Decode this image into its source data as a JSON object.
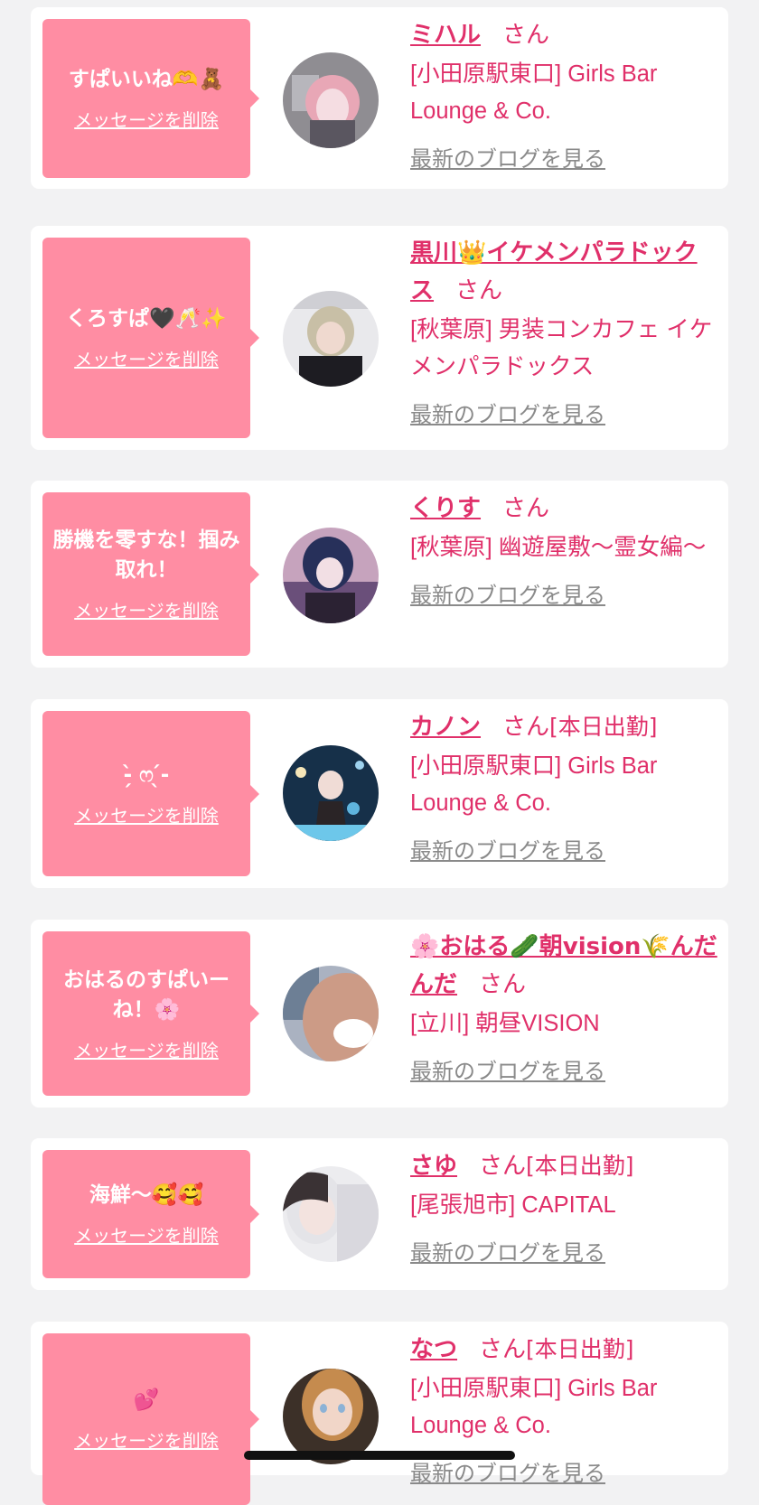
{
  "messages": [
    {
      "bubble_text": "すぱいいね🫶🧸",
      "delete_label": "メッセージを削除",
      "name": "ミハル",
      "suffix": "さん",
      "status": "",
      "shop": "[小田原駅東口] Girls Bar Lounge & Co.",
      "blog_link": "最新のブログを見る"
    },
    {
      "bubble_text": "くろすぱ🖤🥂✨",
      "delete_label": "メッセージを削除",
      "name": "黒川👑イケメンパラドックス",
      "suffix": "さん",
      "status": "",
      "shop": "[秋葉原] 男装コンカフェ イケメンパラドックス",
      "blog_link": "最新のブログを見る"
    },
    {
      "bubble_text": "勝機を零すな！掴み取れ！",
      "delete_label": "メッセージを削除",
      "name": "くりす",
      "suffix": "さん",
      "status": "",
      "shop": "[秋葉原] 幽遊屋敷～霊女編～",
      "blog_link": "最新のブログを見る"
    },
    {
      "bubble_text": "-̗̀ ෆ  ̖́-",
      "delete_label": "メッセージを削除",
      "name": "カノン",
      "suffix": "さん",
      "status": "[本日出勤]",
      "shop": "[小田原駅東口] Girls Bar Lounge & Co.",
      "blog_link": "最新のブログを見る"
    },
    {
      "bubble_text": "おはるのすぱいーね！🌸",
      "delete_label": "メッセージを削除",
      "name": "🌸おはる🥒朝vision🌾んだんだ",
      "suffix": "さん",
      "status": "",
      "shop": "[立川] 朝昼VISION",
      "blog_link": "最新のブログを見る"
    },
    {
      "bubble_text": "海鮮～🥰🥰",
      "delete_label": "メッセージを削除",
      "name": "さゆ",
      "suffix": "さん",
      "status": "[本日出勤]",
      "shop": "[尾張旭市] CAPITAL",
      "blog_link": "最新のブログを見る"
    },
    {
      "bubble_text": "💕",
      "delete_label": "メッセージを削除",
      "name": "なつ",
      "suffix": "さん",
      "status": "[本日出勤]",
      "shop": "[小田原駅東口] Girls Bar Lounge & Co.",
      "blog_link": "最新のブログを見る"
    }
  ],
  "colors": {
    "accent": "#e0306a",
    "bubble": "#ff8da3",
    "background": "#f2f2f3",
    "link_gray": "#8a8a8a"
  }
}
